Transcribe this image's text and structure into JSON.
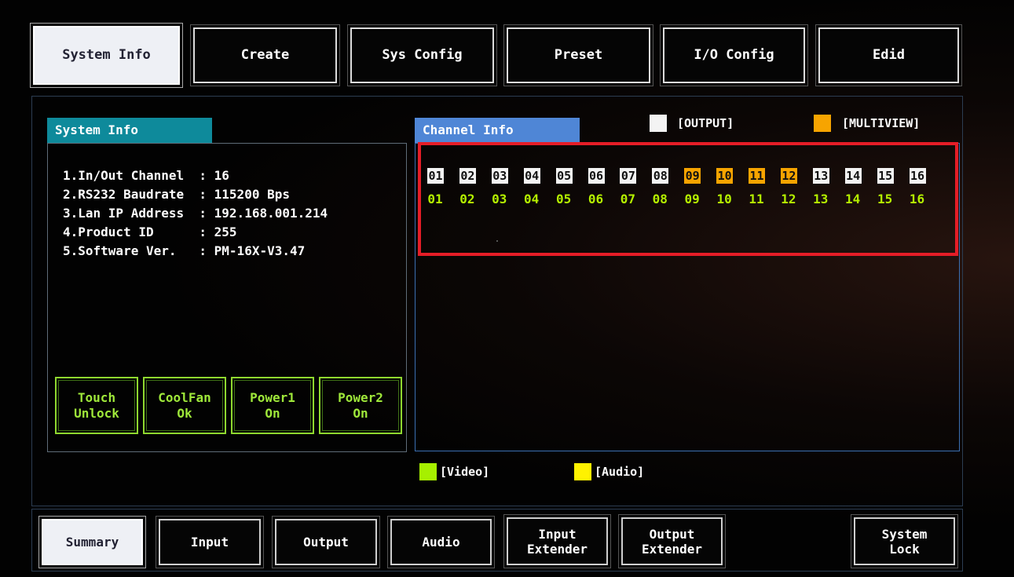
{
  "top_tabs": [
    {
      "label": "System Info",
      "active": true
    },
    {
      "label": "Create",
      "active": false
    },
    {
      "label": "Sys Config",
      "active": false
    },
    {
      "label": "Preset",
      "active": false
    },
    {
      "label": "I/O Config",
      "active": false
    },
    {
      "label": "Edid",
      "active": false
    }
  ],
  "system_info": {
    "title": "System Info",
    "lines": [
      "1.In/Out Channel  : 16",
      "2.RS232 Baudrate  : 115200 Bps",
      "3.Lan IP Address  : 192.168.001.214",
      "4.Product ID      : 255",
      "5.Software Ver.   : PM-16X-V3.47"
    ],
    "status_buttons": [
      {
        "line1": "Touch",
        "line2": "Unlock"
      },
      {
        "line1": "CoolFan",
        "line2": "Ok"
      },
      {
        "line1": "Power1",
        "line2": "On"
      },
      {
        "line1": "Power2",
        "line2": "On"
      }
    ]
  },
  "channel_info": {
    "title": "Channel Info",
    "legend_output": "[OUTPUT]",
    "legend_multiview": "[MULTIVIEW]",
    "legend_video": "[Video]",
    "legend_audio": "[Audio]",
    "colors": {
      "output": "#f3f3f3",
      "multiview": "#f7a400",
      "video": "#a6f000",
      "audio": "#fff200",
      "highlight": "#e51d27"
    },
    "outputs": [
      {
        "num": "01",
        "type": "output"
      },
      {
        "num": "02",
        "type": "output"
      },
      {
        "num": "03",
        "type": "output"
      },
      {
        "num": "04",
        "type": "output"
      },
      {
        "num": "05",
        "type": "output"
      },
      {
        "num": "06",
        "type": "output"
      },
      {
        "num": "07",
        "type": "output"
      },
      {
        "num": "08",
        "type": "output"
      },
      {
        "num": "09",
        "type": "multiview"
      },
      {
        "num": "10",
        "type": "multiview"
      },
      {
        "num": "11",
        "type": "multiview"
      },
      {
        "num": "12",
        "type": "multiview"
      },
      {
        "num": "13",
        "type": "output"
      },
      {
        "num": "14",
        "type": "output"
      },
      {
        "num": "15",
        "type": "output"
      },
      {
        "num": "16",
        "type": "output"
      }
    ],
    "inputs": [
      "01",
      "02",
      "03",
      "04",
      "05",
      "06",
      "07",
      "08",
      "09",
      "10",
      "11",
      "12",
      "13",
      "14",
      "15",
      "16"
    ]
  },
  "bottom_tabs": [
    {
      "label": "Summary",
      "active": true
    },
    {
      "label": "Input",
      "active": false
    },
    {
      "label": "Output",
      "active": false
    },
    {
      "label": "Audio",
      "active": false
    },
    {
      "label": "Input Extender",
      "active": false
    },
    {
      "label": "Output Extender",
      "active": false
    },
    {
      "label": "System Lock",
      "active": false
    }
  ]
}
